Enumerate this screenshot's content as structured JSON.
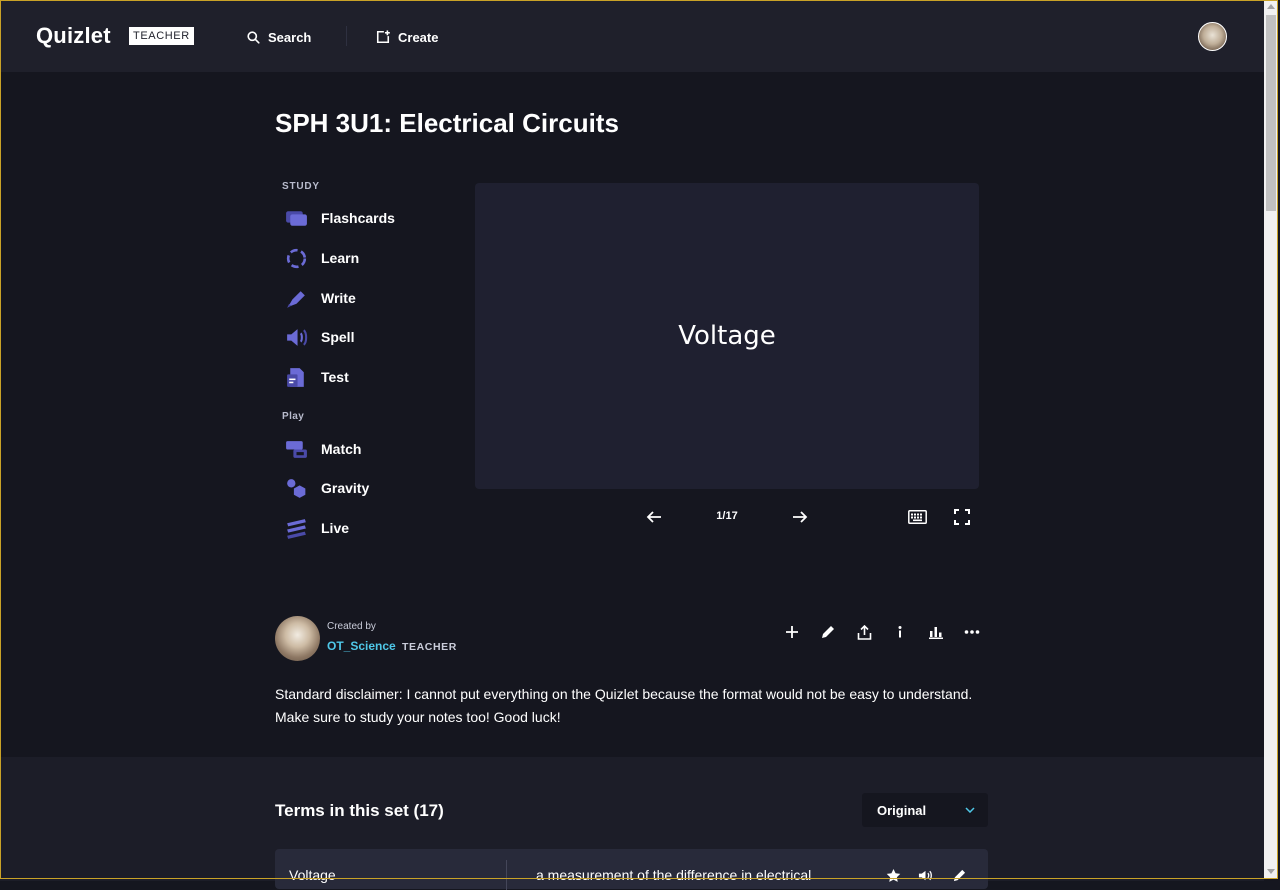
{
  "header": {
    "logo": "Quizlet",
    "badge": "TEACHER",
    "search_label": "Search",
    "create_label": "Create"
  },
  "set": {
    "title": "SPH 3U1: Electrical Circuits"
  },
  "study": {
    "section_label": "STUDY",
    "modes": [
      {
        "label": "Flashcards",
        "icon": "flashcards-icon"
      },
      {
        "label": "Learn",
        "icon": "learn-icon"
      },
      {
        "label": "Write",
        "icon": "write-icon"
      },
      {
        "label": "Spell",
        "icon": "spell-icon"
      },
      {
        "label": "Test",
        "icon": "test-icon"
      }
    ]
  },
  "play": {
    "section_label": "Play",
    "modes": [
      {
        "label": "Match",
        "icon": "match-icon"
      },
      {
        "label": "Gravity",
        "icon": "gravity-icon"
      },
      {
        "label": "Live",
        "icon": "live-icon"
      }
    ]
  },
  "flashcard": {
    "term": "Voltage",
    "counter": "1/17"
  },
  "creator": {
    "created_by": "Created by",
    "username": "OT_Science",
    "role": "TEACHER"
  },
  "description": "Standard disclaimer: I cannot put everything on the Quizlet because the format would not be easy to understand. Make sure to study your notes too! Good luck!",
  "terms": {
    "title": "Terms in this set (17)",
    "sort_value": "Original",
    "rows": [
      {
        "term": "Voltage",
        "definition": "a measurement of the difference in electrical"
      }
    ]
  },
  "colors": {
    "accent": "#6b6bd6",
    "link": "#4fc8e8",
    "background": "#15161f",
    "card": "#1f2030"
  }
}
